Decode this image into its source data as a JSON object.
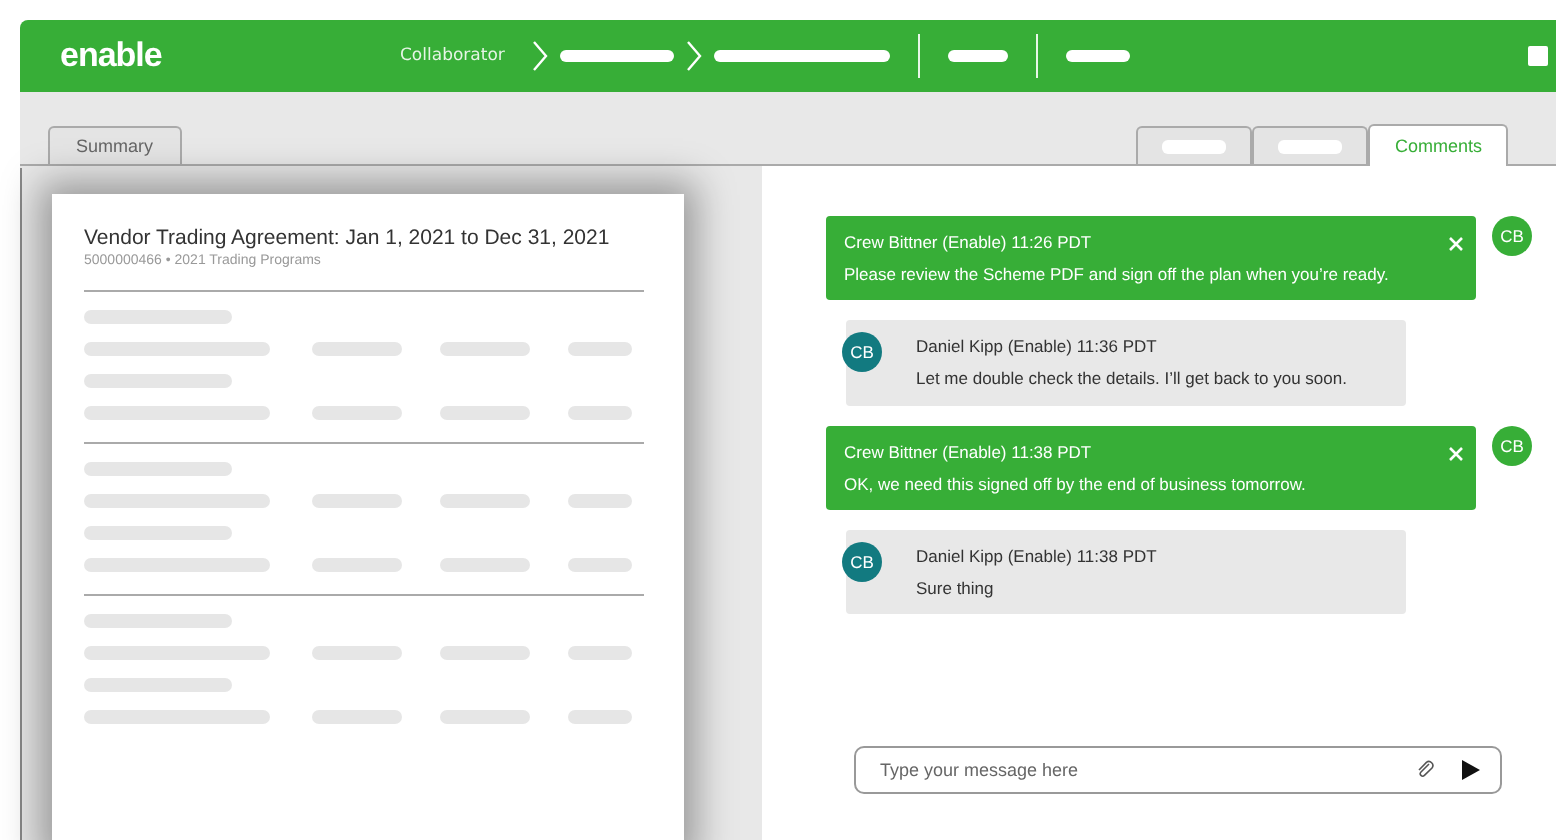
{
  "header": {
    "logo": "enable",
    "breadcrumb": "Collaborator"
  },
  "left_tabs": [
    {
      "label": "Summary",
      "selected": false
    }
  ],
  "right_tabs": [
    {
      "kind": "placeholder",
      "selected": false
    },
    {
      "kind": "placeholder",
      "selected": false
    },
    {
      "kind": "text",
      "label": "Comments",
      "selected": true
    }
  ],
  "document": {
    "title": "Vendor Trading Agreement: Jan 1, 2021 to Dec 31, 2021",
    "subtitle": "5000000466 • 2021  Trading Programs"
  },
  "messages": [
    {
      "kind": "outgoing",
      "author": "Crew Bittner (Enable) 11:26 PDT",
      "text": "Please review the Scheme PDF and sign off the plan when you’re ready.",
      "avatar": "CB"
    },
    {
      "kind": "incoming",
      "author": "Daniel Kipp (Enable) 11:36 PDT",
      "text": "Let me double check the details. I’ll get back to you soon.",
      "avatar": "CB"
    },
    {
      "kind": "outgoing",
      "author": "Crew Bittner (Enable) 11:38 PDT",
      "text": "OK, we need this signed off by the end of business tomorrow.",
      "avatar": "CB"
    },
    {
      "kind": "incoming",
      "author": "Daniel Kipp (Enable) 11:38 PDT",
      "text": "Sure thing",
      "avatar": "CB"
    }
  ],
  "composer": {
    "placeholder": "Type your message here"
  }
}
